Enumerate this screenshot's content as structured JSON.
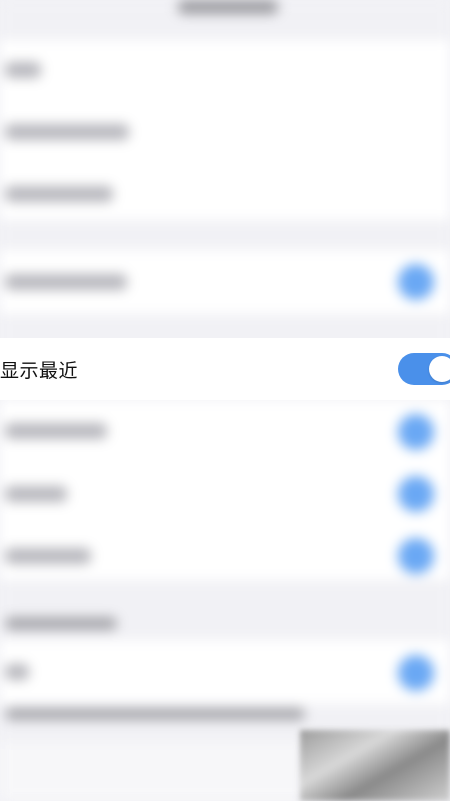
{
  "focused_row": {
    "label": "显示最近",
    "toggle_on": true
  },
  "colors": {
    "accent": "#4a90ea",
    "background": "#f2f2f6"
  }
}
